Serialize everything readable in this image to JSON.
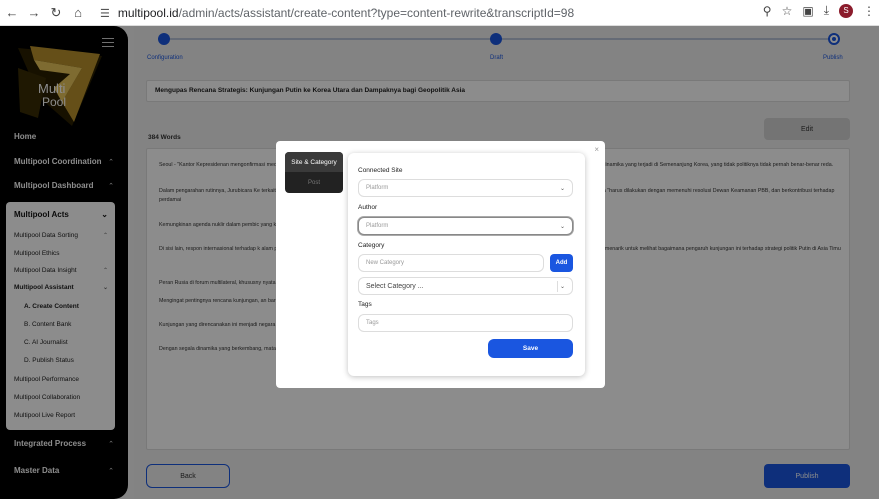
{
  "browser": {
    "url_host": "multipool.id",
    "url_path": "/admin/acts/assistant/create-content?type=content-rewrite&transcriptId=98",
    "profile_initial": "S"
  },
  "sidebar": {
    "logo_line1": "Multi",
    "logo_line2": "Pool",
    "items": [
      {
        "label": "Home"
      },
      {
        "label": "Multipool Coordination"
      },
      {
        "label": "Multipool Dashboard"
      }
    ],
    "acts": {
      "label": "Multipool Acts",
      "subitems": [
        {
          "label": "Multipool Data Sorting"
        },
        {
          "label": "Multipool Ethics"
        },
        {
          "label": "Multipool Data Insight"
        },
        {
          "label": "Multipool Assistant"
        }
      ],
      "assistant_children": [
        {
          "label": "A. Create Content"
        },
        {
          "label": "B. Content Bank"
        },
        {
          "label": "C. AI Journalist"
        },
        {
          "label": "D. Publish Status"
        }
      ],
      "more": [
        {
          "label": "Multipool Performance"
        },
        {
          "label": "Multipool Collaboration"
        },
        {
          "label": "Multipool Live Report"
        }
      ]
    },
    "bottom_items": [
      {
        "label": "Integrated Process"
      },
      {
        "label": "Master Data"
      }
    ]
  },
  "steps": {
    "configuration": "Configuration",
    "draft": "Draft",
    "publish": "Publish"
  },
  "main": {
    "title": "Mengupas Rencana Strategis: Kunjungan Putin ke Korea Utara dan Dampaknya bagi Geopolitik Asia",
    "word_count": "384 Words",
    "edit_label": "Edit",
    "back_label": "Back",
    "publish_label": "Publish",
    "paragraphs": [
      "Seoul - \"Kantor Kepresidenan mengonfirmasi                                                                                                                                                   media internasional. Kunjungan ini menandai episode baru dalam hubungan diplomatik Rusia-Korea Utara, yang terus berkembang                                                                                                                              memantau dinamika yang terjadi di Semenanjung Korea, yang tidak politiknya tidak pernah benar-benar reda.",
      "Dalam pengarahan rutinnya, Jurubicara Ke                                                                                                                                                    terkait masalah Semenanjung Korea.\" Meski demikian, ini tidak menyebutkan detail lebih lanjut mengenai komunikasi tersebut                                                                                                                              gia dan Korea Utara \"harus dilakukan dengan memenuhi resolusi Dewan Keamanan PBB, dan berkontribusi terhadap perdamai",
      "Kemungkinan agenda nuklir dalam pembic                                                                                                                                                     yang kian dinamis. Kunjungan ini juga mengindikasikan adanya kerja sama militer yang mungkin terjadi antara Pyongyang de",
      "Di sisi lain, respon internasional terhadap k                                                                                                                                                  alam pengarahan pada hari Kamis, \"pemerintah pusat dan pemerintah daerah akan melakukan tindakan dan respons untuk ma                                                                                                                              karena itu, sangat menarik untuk melihat bagaimana pengaruh kunjungan ini terhadap strategi politik Putin di Asia Timu",
      "Peran Rusia di forum multilateral, khususny                                                                                                                                                   nyata memiliki efek yang cukup signifikan.",
      "Mengingat pentingnya rencana kunjungan,                                                                                                                                                      an baru untuk mengurangi ketegangan di Semenanjung, atau justru akan menambah kompleksitas pada peta kekuatan global ya",
      "Kunjungan yang direncanakan ini menjadi                                                                                                                                                      negara tersebut dalam strategi geopolitik global Rusia. Ekspektasi terhadap pertemuan kedua pemimpin ini pun menja",
      "Dengan segala dinamika yang berkembang, mata dunia tertuju pada Semenanjung Korea, menanti dampak yang akan dihasilkan dari kunjungan bersejarah ini."
    ]
  },
  "modal": {
    "tab_active": "Site & Category",
    "tab_post": "Post",
    "connected_site_label": "Connected Site",
    "connected_site_placeholder": "Platform",
    "author_label": "Author",
    "author_placeholder": "Platform",
    "category_label": "Category",
    "new_category_placeholder": "New Category",
    "add_label": "Add",
    "select_category_placeholder": "Select Category ...",
    "tags_label": "Tags",
    "tags_placeholder": "Tags",
    "save_label": "Save",
    "close_glyph": "×"
  },
  "colors": {
    "accent": "#1a56e0",
    "sidebar_bg": "#000000"
  }
}
